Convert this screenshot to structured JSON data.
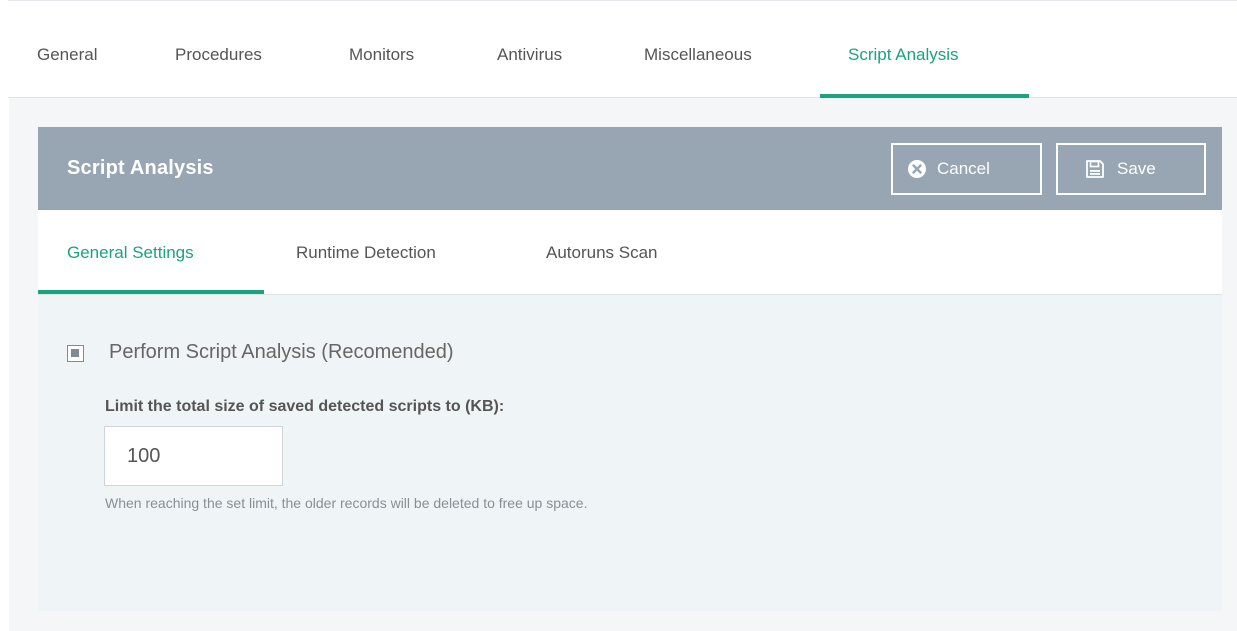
{
  "top_tabs": [
    {
      "label": "General"
    },
    {
      "label": "Procedures"
    },
    {
      "label": "Monitors"
    },
    {
      "label": "Antivirus"
    },
    {
      "label": "Miscellaneous"
    },
    {
      "label": "Script Analysis",
      "active": true
    }
  ],
  "panel": {
    "title": "Script Analysis",
    "cancel_label": "Cancel",
    "save_label": "Save",
    "cancel_icon": "x-circle-icon",
    "save_icon": "floppy-disk-icon"
  },
  "sub_tabs": [
    {
      "label": "General Settings",
      "active": true
    },
    {
      "label": "Runtime Detection"
    },
    {
      "label": "Autoruns Scan"
    }
  ],
  "settings": {
    "perform_label": "Perform Script Analysis (Recomended)",
    "perform_checked": "partial",
    "limit_label": "Limit the total size of saved detected scripts to (KB):",
    "limit_value": "100",
    "help_text": "When reaching the set limit, the older records will be deleted to free up space."
  },
  "colors": {
    "accent": "#1aa380",
    "header_bg": "#97a6b2",
    "panel_bg": "#eff4f6"
  }
}
